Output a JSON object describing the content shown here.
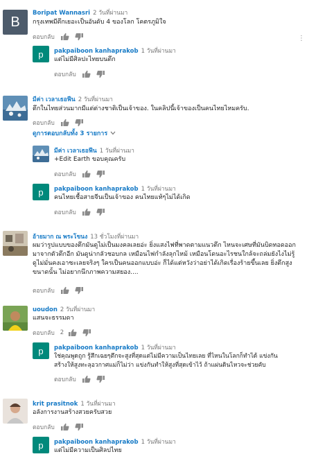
{
  "ui": {
    "reply_label": "ตอบกลับ",
    "view_replies": "ดูการตอบกลับทั้ง 3 รายการ",
    "like_count": "2",
    "accent_color": "#167ac6",
    "icons": [
      "thumbs-up-icon",
      "thumbs-down-icon",
      "chevron-down-icon"
    ]
  },
  "comments": [
    {
      "author": "Boripat Wannasri",
      "time": "2 วันที่ผ่านมา",
      "text": "กรุงเทพมีตึกเยอะเป็นอันดับ 4 ของโลก โคตรภูมิใจ",
      "avatar_letter": "B",
      "avatar_color": "#4d5b6b"
    },
    {
      "author": "pakpaiboon kanhaprakob",
      "time": "1 วันที่ผ่านมา",
      "text": "แต่ไม่มีศิลปะไทยบนตึก",
      "avatar_letter": "p",
      "avatar_color": "#00897b"
    },
    {
      "author": "มีค่า เวลาเธอฟีน",
      "time": "2 วันที่ผ่านมา",
      "text": "ตึกในไทยส่วนมากมีแต่ต่างชาติเป็นเจ้าของ.  ในคลิปนี้เจ้าของเป็นคนไทยไหมครับ."
    },
    {
      "author": "มีค่า เวลาเธอฟีน",
      "time": "1 วันที่ผ่านมา",
      "text": "+Edit Earth ขอบคุณครับ"
    },
    {
      "author": "pakpaiboon kanhaprakob",
      "time": "1 วันที่ผ่านมา",
      "text": "คนไทยเชื้อสายจีนเป็นเจ้าของ คนไทยแท้ๆไม่ได้เกิด",
      "avatar_letter": "p",
      "avatar_color": "#00897b"
    },
    {
      "author": "อ้ายมาก ณ พระโขนง",
      "time": "13 ชั่วโมงที่ผ่านมา",
      "text_lines": [
        "ผมว่ารูปแบบของตึกมันดูไม่เป็นมงคลเลยอ่ะ ยิ่งแสงไฟที่พาดตามแนวตึก ไหนจะเศษที่มันบิดทอดออก",
        "มาจากตัวตึกอีก มันดูน่ากลัวชอบกล เหมือนไฟกำลังลุกไหม้ เหมือนโดนอะไรชนใกล้จะถล่มยังไงไม่รู้",
        "ดูไม่มั่นคงเอาซะเลยจริงๆ ใครเป็นคนออกแบบอ่ะ ก็ได้แต่หวังว่าอย่าได้เกิดเรื่องร้ายขึ้นเลย ยิ่งตึกสูง",
        "ขนาดนั้น ไม่อยากนึกภาพความสยอง...."
      ]
    },
    {
      "author": "uoudon",
      "time": "2 วันที่ผ่านมา",
      "text": "แสนจะธรรมดา"
    },
    {
      "author": "pakpaiboon kanhaprakob",
      "time": "1 วันที่ผ่านมา",
      "text_lines": [
        "ใช่คุณพูดถูก รู้สึกเฉยๆตึกจะสูงที่สุดแต่ไม่มีความเป็นไทยเลย ที่ไหนในโลกก็ทำได้ แข่งกัน",
        "สร้างให้สูงทะลุอวกาศแม่ก็ไม่ว่า แข่งกันทำให้สูงที่สุดเข้าไว้ ถ้าแผ่นดินไหวจะช่วยคับ"
      ],
      "avatar_letter": "p",
      "avatar_color": "#00897b"
    },
    {
      "author": "krit prasitnok",
      "time": "1 วันที่ผ่านมา",
      "text": "อลังการงานสร้างสวยครับสวย"
    },
    {
      "author": "pakpaiboon kanhaprakob",
      "time": "1 วันที่ผ่านมา",
      "text": "แต่ไม่มีความเป็นศิลปไทย",
      "avatar_letter": "p",
      "avatar_color": "#00897b"
    }
  ]
}
